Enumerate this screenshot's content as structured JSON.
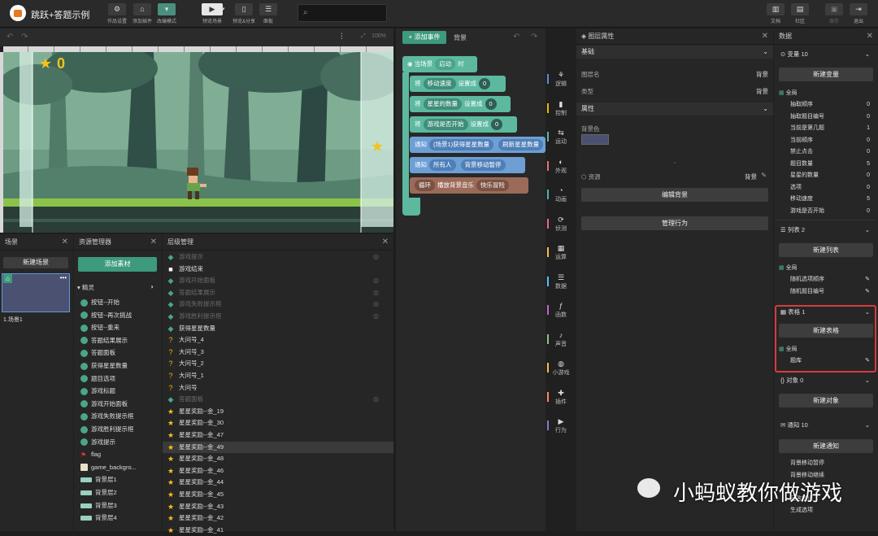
{
  "app": {
    "title": "跳跃+答题示例"
  },
  "toolbar": {
    "work_settings": "作品设置",
    "add_plugin": "添加插件",
    "modify_mode": "改编模式",
    "preview": "预览场景",
    "preview_share": "预览&分享",
    "panel": "面板",
    "docs": "文档",
    "community": "社区",
    "save": "保存",
    "exit": "退出"
  },
  "stage": {
    "zoom": "100%",
    "score": "0"
  },
  "scenes": {
    "title": "场景",
    "new_button": "新建场景",
    "scene_label": "1.场景1"
  },
  "assets": {
    "title": "资源管理器",
    "add_button": "添加素材",
    "group_label": "精灵",
    "items": [
      "按钮--开始",
      "按钮--再次挑战",
      "按钮--重来",
      "答题结果展示",
      "答题面板",
      "获得星星数量",
      "题目选项",
      "游戏标题",
      "游戏开始面板",
      "游戏失败提示框",
      "游戏胜利提示框",
      "游戏提示",
      "flag",
      "game_backgro...",
      "背景层1",
      "背景层2",
      "背景层3",
      "背景层4"
    ]
  },
  "layers": {
    "title": "层级管理",
    "items": [
      "游戏提示",
      "游戏结束",
      "游戏开始面板",
      "答题结果展示",
      "游戏失败提示框",
      "游戏胜利提示框",
      "获得星星数量",
      "大问号_4",
      "大问号_3",
      "大问号_2",
      "大问号_1",
      "大问号",
      "答题面板",
      "星星奖励--金_19",
      "星星奖励--金_30",
      "星星奖励--金_47",
      "星星奖励--金_49",
      "星星奖励--金_48",
      "星星奖励--金_46",
      "星星奖励--金_44",
      "星星奖励--金_45",
      "星星奖励--金_43",
      "星星奖励--金_42",
      "星星奖励--金_41"
    ]
  },
  "code": {
    "add_event": "添加事件",
    "tab_background": "背景",
    "event_prefix": "当场景",
    "event_state": "启动",
    "event_suffix": "时",
    "blocks": [
      {
        "kw": "将",
        "var": "移动速度",
        "mid": "设置成",
        "val": "0"
      },
      {
        "kw": "将",
        "var": "星星的数量",
        "mid": "设置成",
        "val": "0"
      },
      {
        "kw": "将",
        "var": "游戏是否开始",
        "mid": "设置成",
        "val": "0"
      }
    ],
    "notify1": {
      "kw": "通知",
      "target": "(场景1)获得星星数量",
      "msg": "刷新星星数量"
    },
    "notify2": {
      "kw": "通知",
      "target": "所有人",
      "msg": "背景移动暂停"
    },
    "loop": {
      "kw": "循环",
      "action": "播放背景音乐",
      "sound": "快乐冒险"
    }
  },
  "categories": [
    "逻辑",
    "控制",
    "运动",
    "外观",
    "动画",
    "侦测",
    "运算",
    "数据",
    "函数",
    "声音",
    "小游戏",
    "插件",
    "行为"
  ],
  "props": {
    "title": "图层属性",
    "basic": "基础",
    "layer_name_label": "图层名",
    "layer_name_value": "背景",
    "type_label": "类型",
    "type_value": "背景",
    "attrs": "属性",
    "bg_color_label": "背景色",
    "resource_label": "资源",
    "resource_value": "背景",
    "edit_bg": "编辑背景",
    "manage_behavior": "管理行为"
  },
  "data_panel": {
    "title": "数据",
    "variables_header": "变量 10",
    "new_variable": "新建变量",
    "global": "全局",
    "variables": [
      {
        "name": "抽取顺序",
        "value": "0"
      },
      {
        "name": "抽取题目编号",
        "value": "0"
      },
      {
        "name": "当前是第几题",
        "value": "1"
      },
      {
        "name": "当前顺序",
        "value": "0"
      },
      {
        "name": "禁止点击",
        "value": "0"
      },
      {
        "name": "题目数量",
        "value": "5"
      },
      {
        "name": "星星的数量",
        "value": "0"
      },
      {
        "name": "选项",
        "value": "0"
      },
      {
        "name": "移动速度",
        "value": "5"
      },
      {
        "name": "游戏是否开始",
        "value": "0"
      }
    ],
    "lists_header": "列表 2",
    "new_list": "新建列表",
    "lists": [
      "随机选项顺序",
      "随机题目编号"
    ],
    "tables_header": "表格 1",
    "new_table": "新建表格",
    "tables": [
      "题库"
    ],
    "objects_header": "对象 0",
    "new_object": "新建对象",
    "notify_header": "通知 10",
    "new_notify": "新建通知",
    "notifications": [
      "背景移动暂停",
      "背景移动继续",
      "",
      "回答错误",
      "生成选项"
    ]
  },
  "watermark": "小蚂蚁教你做游戏",
  "colors": {
    "accent": "#3d9a7c",
    "highlight_border": "#d63c3c"
  }
}
